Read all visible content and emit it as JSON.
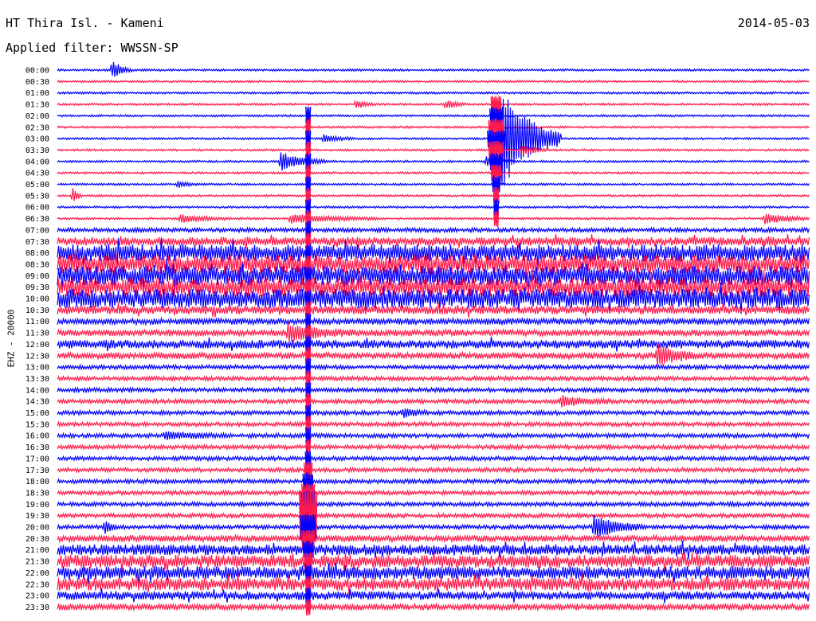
{
  "header": {
    "station": "HT Thira Isl. - Kameni",
    "date": "2014-05-03",
    "filter": "Applied filter: WWSSN-SP"
  },
  "chart_data": {
    "type": "line",
    "title": "HT Thira Isl. - Kameni",
    "ylabel": "EHZ - 20000",
    "row_labels": [
      "00:00",
      "00:30",
      "01:00",
      "01:30",
      "02:00",
      "02:30",
      "03:00",
      "03:30",
      "04:00",
      "04:30",
      "05:00",
      "05:30",
      "06:00",
      "06:30",
      "07:00",
      "07:30",
      "08:00",
      "08:30",
      "09:00",
      "09:30",
      "10:00",
      "10:30",
      "11:00",
      "11:30",
      "12:00",
      "12:30",
      "13:00",
      "13:30",
      "14:00",
      "14:30",
      "15:00",
      "15:30",
      "16:00",
      "16:30",
      "17:00",
      "17:30",
      "18:00",
      "18:30",
      "19:00",
      "19:30",
      "20:00",
      "20:30",
      "21:00",
      "21:30",
      "22:00",
      "22:30",
      "23:00",
      "23:30"
    ],
    "trace_colors": [
      "#0000ff",
      "#ff1a4b"
    ],
    "xlim": [
      0,
      30
    ],
    "x_unit": "minutes within trace row",
    "noise_level": [
      1,
      1,
      1,
      1,
      1,
      1,
      1,
      1,
      1,
      1,
      1,
      1,
      1,
      1,
      2,
      4,
      8,
      9,
      9,
      9,
      9,
      4,
      3,
      3,
      4,
      3,
      2,
      2,
      2,
      2,
      2,
      2,
      2,
      2,
      2,
      2,
      2,
      2,
      2,
      2,
      2,
      3,
      5,
      6,
      6,
      6,
      4,
      3
    ],
    "events": [
      {
        "row": "00:00",
        "minute": 2.2,
        "amplitude": 12,
        "duration": 0.8
      },
      {
        "row": "01:30",
        "minute": 11.9,
        "amplitude": 6,
        "duration": 0.8
      },
      {
        "row": "01:30",
        "minute": 15.5,
        "amplitude": 6,
        "duration": 0.8
      },
      {
        "row": "03:00",
        "minute": 10.6,
        "amplitude": 5,
        "duration": 1.2
      },
      {
        "row": "03:00",
        "minute": 17.6,
        "amplitude": 70,
        "duration": 2.5
      },
      {
        "row": "03:30",
        "minute": 18.5,
        "amplitude": 7,
        "duration": 1.0
      },
      {
        "row": "04:00",
        "minute": 8.9,
        "amplitude": 12,
        "duration": 1.8
      },
      {
        "row": "04:00",
        "minute": 17.1,
        "amplitude": 6,
        "duration": 1.0
      },
      {
        "row": "05:00",
        "minute": 4.8,
        "amplitude": 4,
        "duration": 0.8
      },
      {
        "row": "05:30",
        "minute": 0.6,
        "amplitude": 10,
        "duration": 0.4
      },
      {
        "row": "06:30",
        "minute": 4.9,
        "amplitude": 5,
        "duration": 2.0
      },
      {
        "row": "06:30",
        "minute": 9.3,
        "amplitude": 6,
        "duration": 3.5
      },
      {
        "row": "06:30",
        "minute": 28.2,
        "amplitude": 7,
        "duration": 1.8
      },
      {
        "row": "11:30",
        "minute": 9.2,
        "amplitude": 10,
        "duration": 2.5
      },
      {
        "row": "12:30",
        "minute": 23.9,
        "amplitude": 14,
        "duration": 1.5
      },
      {
        "row": "14:30",
        "minute": 20.1,
        "amplitude": 6,
        "duration": 2.0
      },
      {
        "row": "15:00",
        "minute": 13.8,
        "amplitude": 5,
        "duration": 1.0
      },
      {
        "row": "16:00",
        "minute": 4.3,
        "amplitude": 4,
        "duration": 2.5
      },
      {
        "row": "20:00",
        "minute": 1.9,
        "amplitude": 8,
        "duration": 0.5
      },
      {
        "row": "20:00",
        "minute": 21.4,
        "amplitude": 14,
        "duration": 2.0
      }
    ],
    "spikes": [
      {
        "minute": 10.0,
        "start_row": "02:00",
        "end_row": "23:30",
        "peak_row": "19:30",
        "amplitude": 220
      },
      {
        "minute": 17.5,
        "start_row": "01:30",
        "end_row": "06:30",
        "peak_row": "03:00",
        "amplitude": 60
      }
    ],
    "grid": false,
    "legend": "none"
  }
}
